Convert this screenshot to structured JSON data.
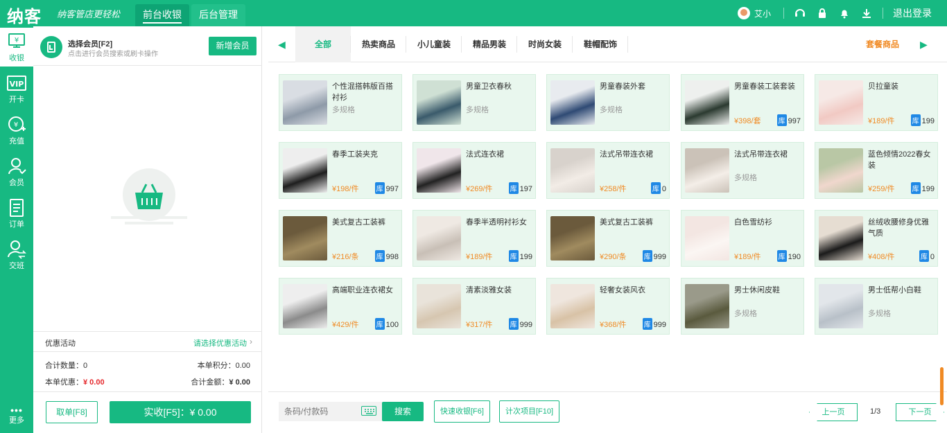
{
  "app": {
    "logo": "纳客",
    "slogan": "纳客管店更轻松",
    "nav_tabs": [
      "前台收银",
      "后台管理"
    ],
    "user_name": "艾小",
    "logout": "退出登录"
  },
  "sidebar": {
    "items": [
      {
        "label": "收银",
        "icon": "cashier-icon"
      },
      {
        "label": "开卡",
        "icon": "vip-card-icon"
      },
      {
        "label": "充值",
        "icon": "recharge-icon"
      },
      {
        "label": "会员",
        "icon": "member-icon"
      },
      {
        "label": "订单",
        "icon": "order-icon"
      },
      {
        "label": "交班",
        "icon": "handover-icon"
      }
    ],
    "more": "更多"
  },
  "cashier": {
    "select_member": "选择会员[F2]",
    "member_hint": "点击进行会员搜索或刷卡操作",
    "add_member": "新增会员",
    "promo_label": "优惠活动",
    "promo_link": "请选择优惠活动",
    "total_qty_label": "合计数量：",
    "total_qty": "0",
    "points_label": "本单积分：",
    "points": "0.00",
    "discount_label": "本单优惠：",
    "discount": "¥ 0.00",
    "total_amount_label": "合计金额：",
    "total_amount": "¥ 0.00",
    "cancel_btn": "取单[F8]",
    "pay_btn": "实收[F5]：¥ 0.00"
  },
  "categories": {
    "tabs": [
      "全部",
      "热卖商品",
      "小儿童装",
      "精品男装",
      "时尚女装",
      "鞋帽配饰"
    ],
    "special": "套餐商品"
  },
  "products": [
    {
      "name": "个性混搭韩版百搭衬衫",
      "spec": "多规格",
      "price": "",
      "stock": "",
      "c1": "#d9dde3",
      "c2": "#8e9aa8"
    },
    {
      "name": "男童卫衣春秋",
      "spec": "多规格",
      "price": "",
      "stock": "",
      "c1": "#cfe0d4",
      "c2": "#3a5a6b"
    },
    {
      "name": "男童春装外套",
      "spec": "多规格",
      "price": "",
      "stock": "",
      "c1": "#e8ebef",
      "c2": "#2f4a74"
    },
    {
      "name": "男童春装工装套装",
      "spec": "",
      "price": "¥398/套",
      "stock": "997",
      "c1": "#eef0ee",
      "c2": "#2b3a30"
    },
    {
      "name": "贝拉童装",
      "spec": "",
      "price": "¥189/件",
      "stock": "199",
      "c1": "#f6e9e6",
      "c2": "#f1c9c3"
    },
    {
      "name": "春季工装夹克",
      "spec": "",
      "price": "¥198/件",
      "stock": "997",
      "c1": "#eeeeee",
      "c2": "#1e1e1e"
    },
    {
      "name": "法式连衣裙",
      "spec": "",
      "price": "¥269/件",
      "stock": "197",
      "c1": "#f0e6ea",
      "c2": "#222222"
    },
    {
      "name": "法式吊带连衣裙",
      "spec": "",
      "price": "¥258/件",
      "stock": "0",
      "c1": "#d8d2cc",
      "c2": "#f2ece6"
    },
    {
      "name": "法式吊带连衣裙",
      "spec": "多规格",
      "price": "",
      "stock": "",
      "c1": "#cbc2b8",
      "c2": "#f4eee8"
    },
    {
      "name": "蓝色倾情2022春女装",
      "spec": "",
      "price": "¥259/件",
      "stock": "199",
      "c1": "#b9c7a5",
      "c2": "#f0d7cd"
    },
    {
      "name": "美式复古工装裤",
      "spec": "",
      "price": "¥216/条",
      "stock": "998",
      "c1": "#6b5a3c",
      "c2": "#a08b5f"
    },
    {
      "name": "春季半透明衬衫女",
      "spec": "",
      "price": "¥189/件",
      "stock": "199",
      "c1": "#efe9e3",
      "c2": "#c8bfb6"
    },
    {
      "name": "美式复古工装裤",
      "spec": "",
      "price": "¥290/条",
      "stock": "999",
      "c1": "#6b5a3c",
      "c2": "#a08b5f"
    },
    {
      "name": "白色雪纺衫",
      "spec": "",
      "price": "¥189/件",
      "stock": "190",
      "c1": "#f3e6e2",
      "c2": "#fbf6f3"
    },
    {
      "name": "丝绒收腰修身优雅气质",
      "spec": "",
      "price": "¥408/件",
      "stock": "0",
      "c1": "#e6ddd2",
      "c2": "#1b1b1b"
    },
    {
      "name": "高端职业连衣裙女",
      "spec": "",
      "price": "¥429/件",
      "stock": "100",
      "c1": "#eeeeee",
      "c2": "#8b8b8b"
    },
    {
      "name": "清素淡雅女装",
      "spec": "",
      "price": "¥317/件",
      "stock": "999",
      "c1": "#e9e3da",
      "c2": "#d6c6b0"
    },
    {
      "name": "轻奢女装风衣",
      "spec": "",
      "price": "¥368/件",
      "stock": "999",
      "c1": "#efe6de",
      "c2": "#d8c2a6"
    },
    {
      "name": "男士休闲皮鞋",
      "spec": "多规格",
      "price": "",
      "stock": "",
      "c1": "#9a9a8a",
      "c2": "#5a5a3e"
    },
    {
      "name": "男士低帮小白鞋",
      "spec": "多规格",
      "price": "",
      "stock": "",
      "c1": "#e2e6ea",
      "c2": "#b8c0c8"
    }
  ],
  "stock_badge": "库",
  "bottom": {
    "barcode_placeholder": "条码/付款码",
    "search_btn": "搜索",
    "quick_cash": "快速收银[F6]",
    "count_items": "计次项目[F10]",
    "prev": "上一页",
    "page": "1/3",
    "next": "下一页"
  }
}
